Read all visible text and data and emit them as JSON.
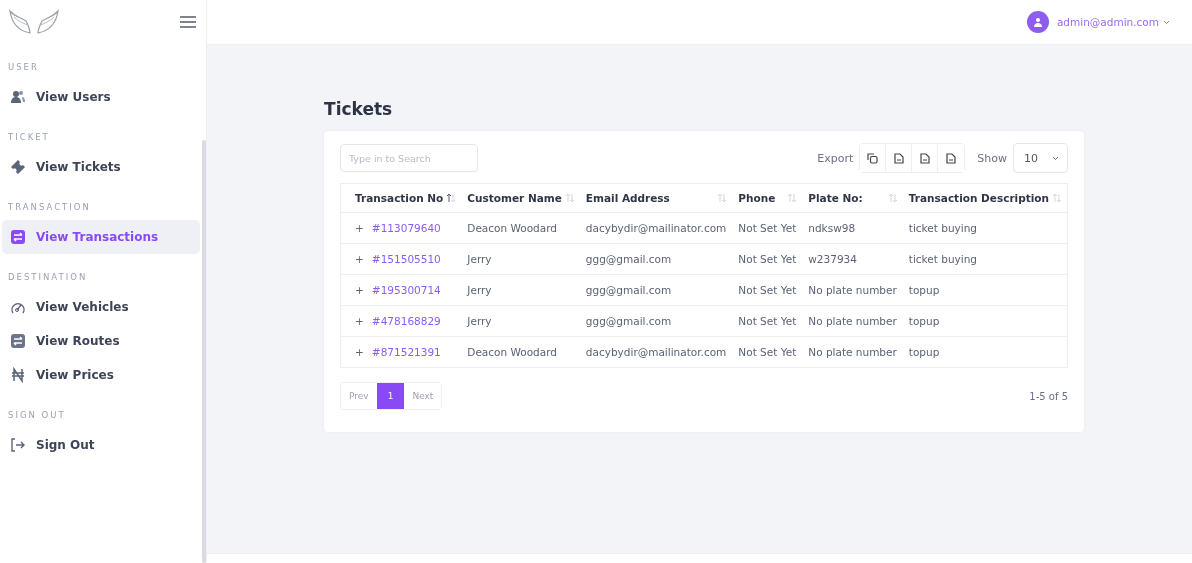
{
  "sidebar": {
    "sections": [
      {
        "title": "USER",
        "items": [
          {
            "label": "View Users",
            "kind": "users",
            "selected": false
          }
        ]
      },
      {
        "title": "TICKET",
        "items": [
          {
            "label": "View Tickets",
            "kind": "ticket",
            "selected": false
          }
        ]
      },
      {
        "title": "TRANSACTION",
        "items": [
          {
            "label": "View Transactions",
            "kind": "transactions",
            "selected": true
          }
        ]
      },
      {
        "title": "DESTINATION",
        "items": [
          {
            "label": "View Vehicles",
            "kind": "vehicles",
            "selected": false
          },
          {
            "label": "View Routes",
            "kind": "routes",
            "selected": false
          },
          {
            "label": "View Prices",
            "kind": "prices",
            "selected": false
          }
        ]
      },
      {
        "title": "SIGN OUT",
        "items": [
          {
            "label": "Sign Out",
            "kind": "signout",
            "selected": false
          }
        ]
      }
    ]
  },
  "topbar": {
    "user": "admin@admin.com"
  },
  "page_title": "Tickets",
  "search": {
    "placeholder": "Type in to Search"
  },
  "export": {
    "label": "Export",
    "buttons": [
      {
        "kind": "copy"
      },
      {
        "kind": "file"
      },
      {
        "kind": "file"
      },
      {
        "kind": "file"
      }
    ]
  },
  "page_size": {
    "label": "Show",
    "value": "10"
  },
  "table": {
    "columns": [
      {
        "label": "Transaction No",
        "sorted": true
      },
      {
        "label": "Customer Name",
        "sorted": false
      },
      {
        "label": "Email Address",
        "sorted": false
      },
      {
        "label": "Phone",
        "sorted": false
      },
      {
        "label": "Plate No:",
        "sorted": false
      },
      {
        "label": "Transaction Description",
        "sorted": false
      }
    ],
    "rows": [
      {
        "expand": "+",
        "cells": [
          "#113079640",
          "Deacon Woodard",
          "dacybydir@mailinator.com",
          "Not Set Yet",
          "ndksw98",
          "ticket buying"
        ]
      },
      {
        "expand": "+",
        "cells": [
          "#151505510",
          "Jerry",
          "ggg@gmail.com",
          "Not Set Yet",
          "w237934",
          "ticket buying"
        ]
      },
      {
        "expand": "+",
        "cells": [
          "#195300714",
          "Jerry",
          "ggg@gmail.com",
          "Not Set Yet",
          "No plate number",
          "topup"
        ]
      },
      {
        "expand": "+",
        "cells": [
          "#478168829",
          "Jerry",
          "ggg@gmail.com",
          "Not Set Yet",
          "No plate number",
          "topup"
        ]
      },
      {
        "expand": "+",
        "cells": [
          "#871521391",
          "Deacon Woodard",
          "dacybydir@mailinator.com",
          "Not Set Yet",
          "No plate number",
          "topup"
        ]
      }
    ]
  },
  "pagination": {
    "pages": [
      {
        "label": "Prev",
        "disabled": true,
        "selected": false
      },
      {
        "label": "1",
        "disabled": false,
        "selected": true
      },
      {
        "label": "Next",
        "disabled": true,
        "selected": false
      }
    ],
    "summary": "1-5 of 5"
  }
}
